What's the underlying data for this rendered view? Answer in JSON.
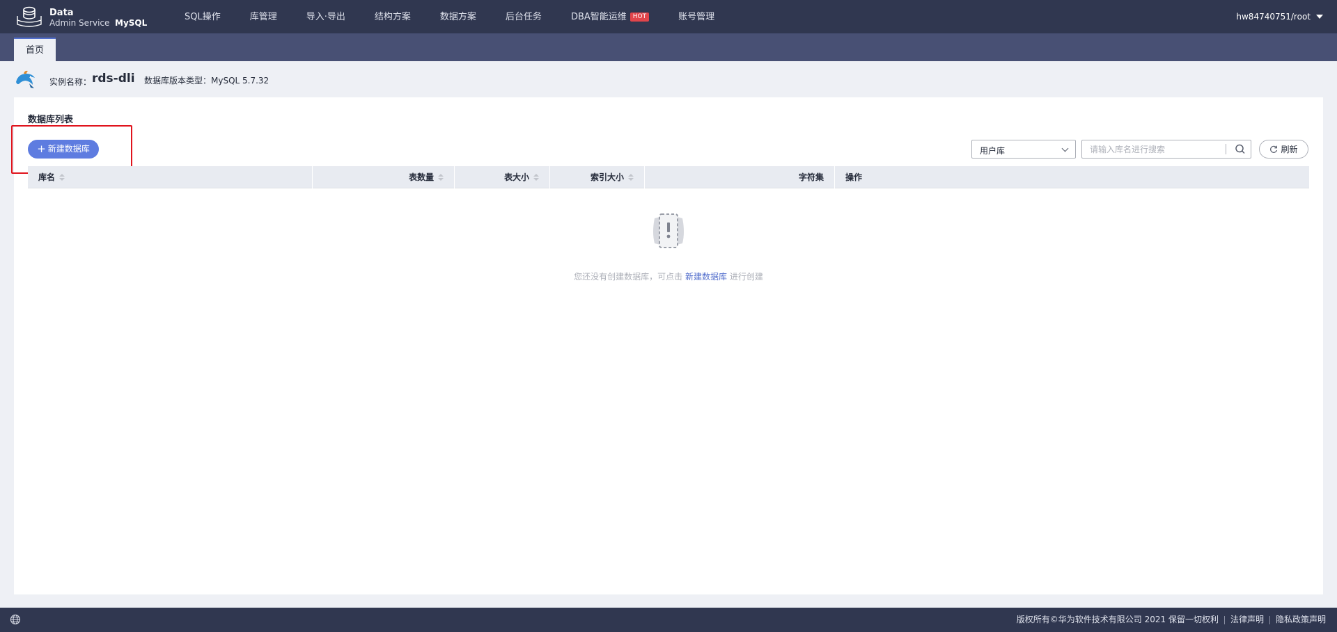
{
  "brand": {
    "line1": "Data",
    "line2": "Admin Service",
    "db_engine": "MySQL"
  },
  "nav": {
    "items": [
      {
        "label": "SQL操作"
      },
      {
        "label": "库管理"
      },
      {
        "label": "导入·导出"
      },
      {
        "label": "结构方案"
      },
      {
        "label": "数据方案"
      },
      {
        "label": "后台任务"
      },
      {
        "label": "DBA智能运维",
        "badge": "HOT"
      },
      {
        "label": "账号管理"
      }
    ],
    "user": "hw84740751/root"
  },
  "tabs": {
    "home": "首页"
  },
  "instance": {
    "label": "实例名称：",
    "name": "rds-dli",
    "version_text": "数据库版本类型：MySQL 5.7.32"
  },
  "db_list": {
    "title": "数据库列表",
    "new_button": "新建数据库",
    "scope_select": "用户库",
    "search_placeholder": "请输入库名进行搜索",
    "refresh_button": "刷新",
    "columns": [
      "库名",
      "表数量",
      "表大小",
      "索引大小",
      "字符集",
      "操作"
    ],
    "empty_text_before": "您还没有创建数据库，可点击 ",
    "empty_link": "新建数据库",
    "empty_text_after": " 进行创建"
  },
  "footer": {
    "copyright": "版权所有©华为软件技术有限公司 2021 保留一切权利",
    "legal": "法律声明",
    "privacy": "隐私政策声明"
  },
  "colors": {
    "topbar": "#303750",
    "tabstrip": "#485074",
    "primary": "#5e7ce0",
    "link": "#526ecc",
    "highlight": "#e0141d",
    "hot": "#e1454b"
  },
  "icons": [
    "database-logo-icon",
    "dolphin-icon",
    "plus-icon",
    "chevron-down-icon",
    "search-icon",
    "refresh-icon",
    "sort-icon",
    "empty-state-icon",
    "globe-icon",
    "caret-down-icon"
  ]
}
